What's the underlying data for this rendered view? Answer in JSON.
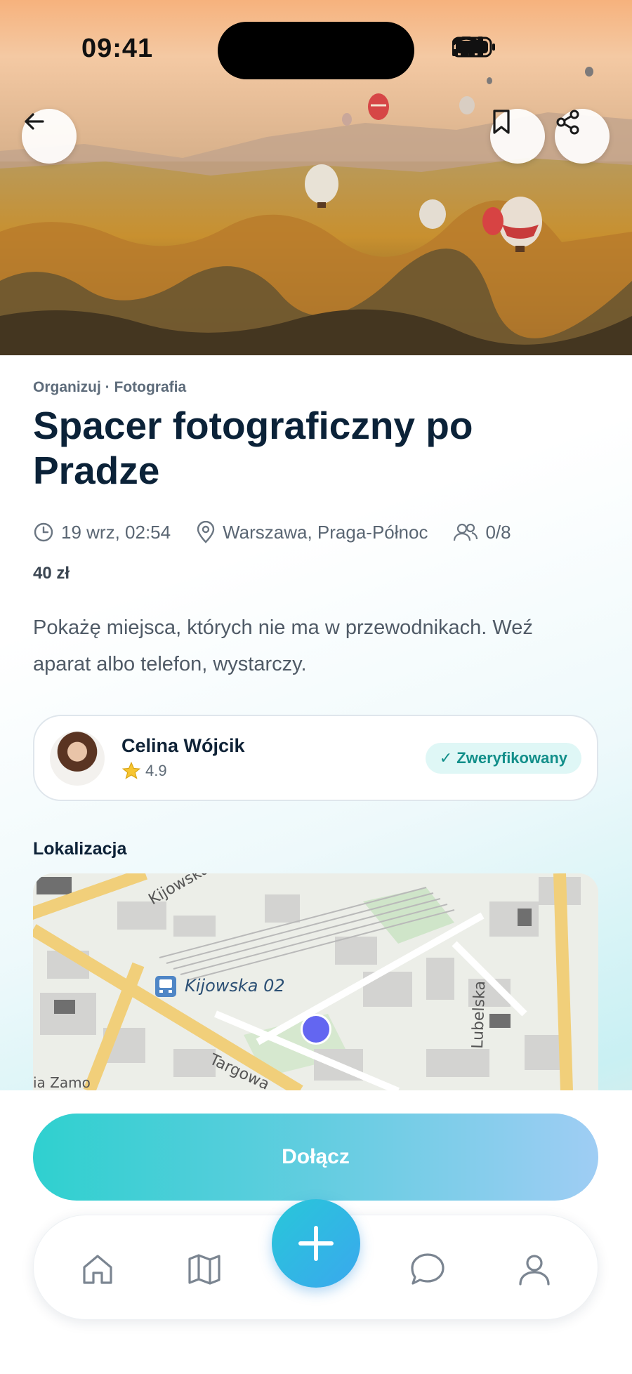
{
  "status_bar": {
    "time": "09:41"
  },
  "header": {
    "back_icon": "arrow-left-icon",
    "bookmark_icon": "bookmark-icon",
    "share_icon": "share-icon"
  },
  "event": {
    "category": "Organizuj · Fotografia",
    "title": "Spacer fotograficzny po Pradze",
    "date": "19 wrz, 02:54",
    "location": "Warszawa, Praga-Północ",
    "participants": "0/8",
    "price": "40 zł",
    "description": "Pokażę miejsca, których nie ma w przewodnikach. Weź aparat albo telefon, wystarczy."
  },
  "host": {
    "name": "Celina Wójcik",
    "rating": "4.9",
    "badge": "✓ Zweryfikowany"
  },
  "location_section": {
    "label": "Lokalizacja",
    "map_labels": [
      "Kijowska 02",
      "Kijowska",
      "Targowa",
      "Lubelska",
      "ia Zamo"
    ]
  },
  "actions": {
    "join_label": "Dołącz"
  },
  "tabbar": {
    "items": [
      "home-icon",
      "map-icon",
      "add-icon",
      "chat-icon",
      "profile-icon"
    ]
  },
  "colors": {
    "accent": "#2fd0cf",
    "accent_end": "#9fcdf4",
    "badge_text": "#128f8a",
    "marker": "#6366f1"
  }
}
